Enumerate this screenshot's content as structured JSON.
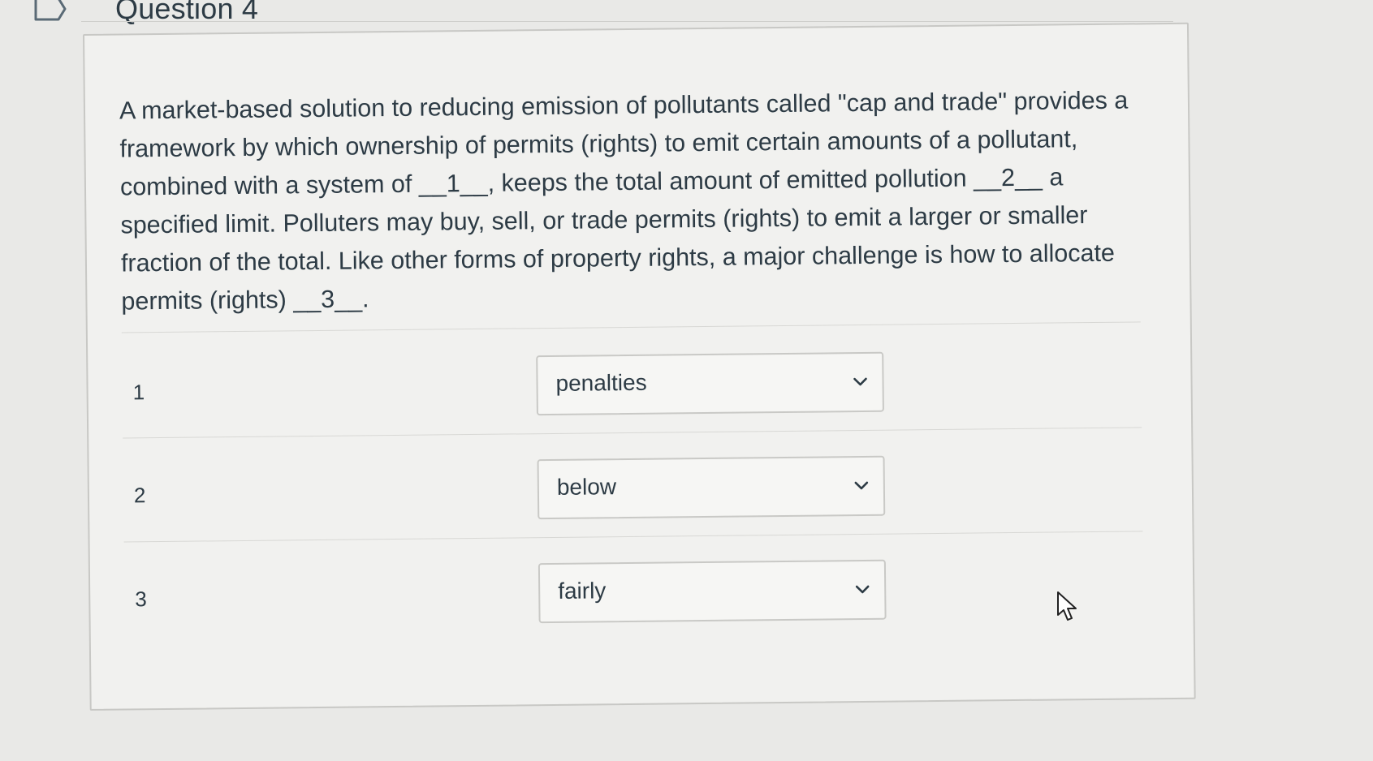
{
  "question": {
    "title": "Question 4",
    "text": "A market-based solution to reducing emission of pollutants called \"cap and trade\" provides a framework by which ownership of permits (rights) to emit certain amounts of a pollutant, combined with a system of __1__, keeps the total amount of emitted pollution __2__ a specified limit. Polluters may buy, sell, or trade permits (rights) to emit a larger or smaller fraction of the total. Like other forms of property rights, a major challenge is how to allocate permits (rights) __3__."
  },
  "answers": [
    {
      "number": "1",
      "selected": "penalties"
    },
    {
      "number": "2",
      "selected": "below"
    },
    {
      "number": "3",
      "selected": "fairly"
    }
  ],
  "icons": {
    "flag": "flag-icon",
    "dropdown": "chevron-down-icon",
    "cursor": "mouse-pointer-icon"
  }
}
